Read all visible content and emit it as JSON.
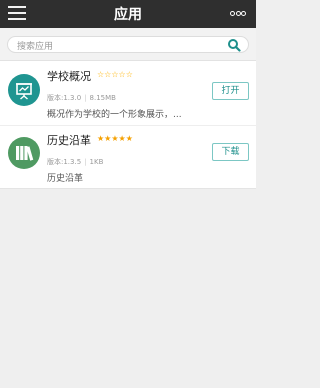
{
  "header": {
    "title": "应用",
    "menu_icon": "hamburger-menu-icon",
    "more_icon": "more-dots-icon"
  },
  "search": {
    "placeholder": "搜索应用",
    "icon": "search-icon"
  },
  "apps": [
    {
      "name": "学校概况",
      "rating": 0,
      "stars": "☆☆☆☆☆",
      "version": "版本:1.3.0",
      "size": "8.15MB",
      "description": "概况作为学校的一个形象展示，...",
      "action": "打开",
      "icon": "presentation-board-icon"
    },
    {
      "name": "历史沿革",
      "rating": 5,
      "stars": "★★★★★",
      "version": "版本:1.3.5",
      "size": "1KB",
      "description": "历史沿革",
      "action": "下载",
      "icon": "books-icon"
    }
  ],
  "colors": {
    "header_bg": "#2f2f2f",
    "accent": "#1d8f8b",
    "star": "#f5a000"
  }
}
